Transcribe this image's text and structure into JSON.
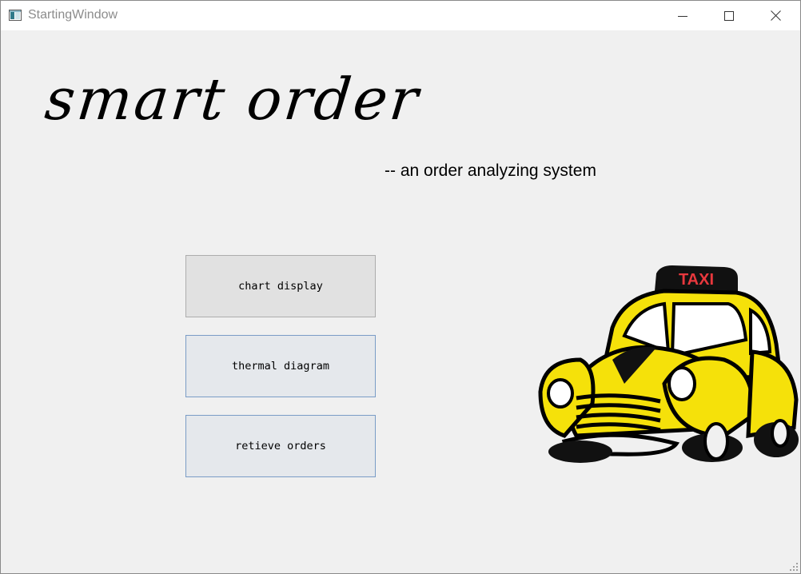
{
  "window": {
    "title": "StartingWindow",
    "controls": {
      "minimize_icon": "minimize-icon",
      "maximize_icon": "maximize-icon",
      "close_icon": "close-icon"
    }
  },
  "main": {
    "title": "smart order",
    "subtitle": "-- an order analyzing system",
    "buttons": [
      {
        "label": "chart display",
        "state": "hovered"
      },
      {
        "label": "thermal diagram",
        "state": "default"
      },
      {
        "label": "retieve orders",
        "state": "default"
      }
    ],
    "illustration": {
      "name": "taxi-illustration",
      "sign_text": "TAXI",
      "colors": {
        "body": "#f5e10a",
        "outline": "#000000",
        "sign": "#e8383d"
      }
    }
  }
}
